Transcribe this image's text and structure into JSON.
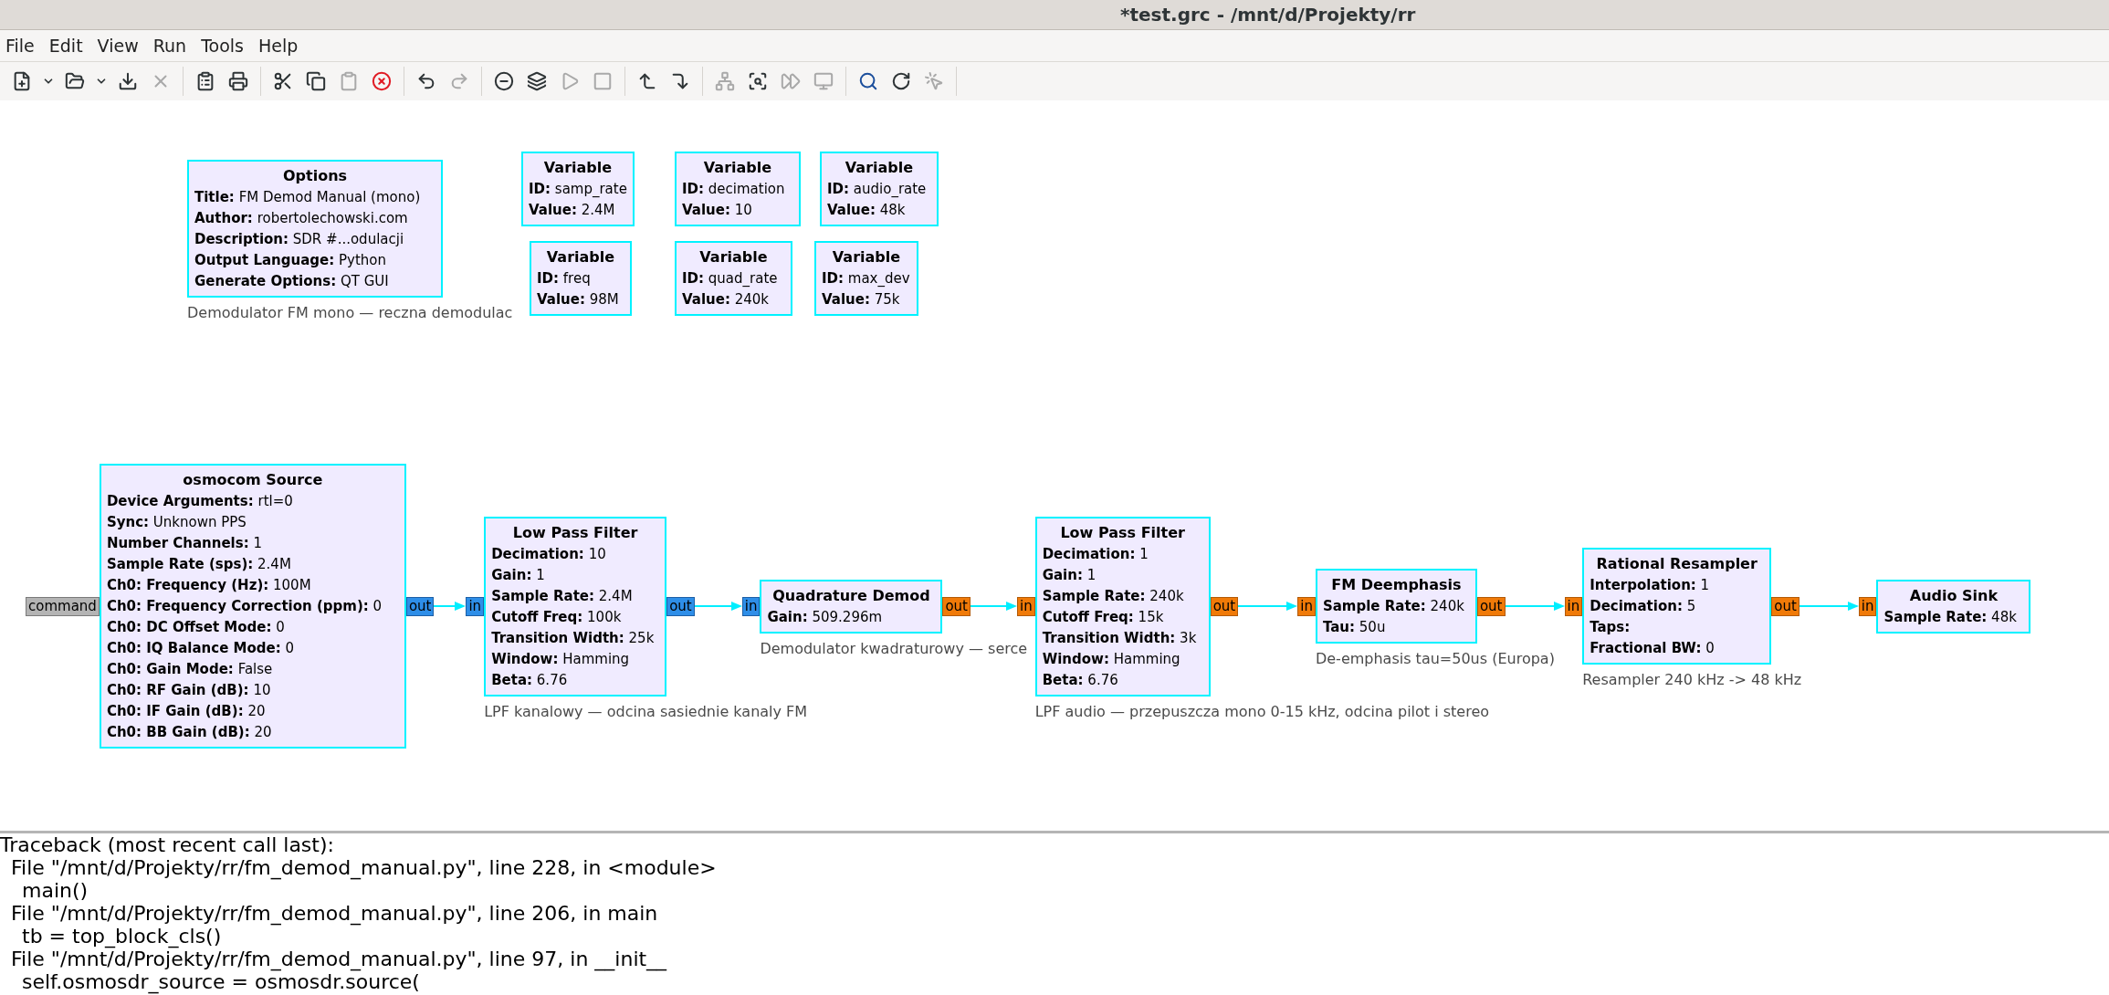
{
  "window": {
    "title": "*test.grc - /mnt/d/Projekty/rr"
  },
  "menu": [
    "File",
    "Edit",
    "View",
    "Run",
    "Tools",
    "Help"
  ],
  "toolbar": [
    [
      {
        "disabled": false
      },
      {
        "disabled": false
      },
      {
        "disabled": false
      },
      {
        "disabled": false
      },
      {
        "disabled": false
      },
      {
        "disabled": true
      }
    ],
    [
      {
        "disabled": false
      },
      {
        "disabled": false
      }
    ],
    [
      {
        "disabled": false
      },
      {
        "disabled": false
      },
      {
        "disabled": true
      },
      {
        "disabled": false
      }
    ],
    [
      {
        "disabled": false
      },
      {
        "disabled": true
      }
    ],
    [
      {
        "disabled": false
      },
      {
        "disabled": false
      },
      {
        "disabled": true
      },
      {
        "disabled": true
      }
    ],
    [
      {
        "disabled": false
      },
      {
        "disabled": false
      }
    ],
    [
      {
        "disabled": true
      },
      {
        "disabled": false
      },
      {
        "disabled": true
      },
      {
        "disabled": true
      }
    ],
    [
      {
        "disabled": false
      },
      {
        "disabled": false
      },
      {
        "disabled": true
      }
    ]
  ],
  "blocks": [
    {
      "title": "Options",
      "params": [
        {
          "name": "Title:",
          "value": "FM Demod Manual (mono)"
        },
        {
          "name": "Author:",
          "value": "robertolechowski.com"
        },
        {
          "name": "Description:",
          "value": "SDR #...odulacji"
        },
        {
          "name": "Output Language:",
          "value": "Python"
        },
        {
          "name": "Generate Options:",
          "value": "QT GUI"
        }
      ],
      "comment": "Demodulator FM mono — reczna demodulac"
    },
    {
      "title": "Variable",
      "params": [
        {
          "name": "ID:",
          "value": "samp_rate"
        },
        {
          "name": "Value:",
          "value": "2.4M"
        }
      ]
    },
    {
      "title": "Variable",
      "params": [
        {
          "name": "ID:",
          "value": "freq"
        },
        {
          "name": "Value:",
          "value": "98M"
        }
      ]
    },
    {
      "title": "Variable",
      "params": [
        {
          "name": "ID:",
          "value": "decimation"
        },
        {
          "name": "Value:",
          "value": "10"
        }
      ]
    },
    {
      "title": "Variable",
      "params": [
        {
          "name": "ID:",
          "value": "quad_rate"
        },
        {
          "name": "Value:",
          "value": "240k"
        }
      ]
    },
    {
      "title": "Variable",
      "params": [
        {
          "name": "ID:",
          "value": "audio_rate"
        },
        {
          "name": "Value:",
          "value": "48k"
        }
      ]
    },
    {
      "title": "Variable",
      "params": [
        {
          "name": "ID:",
          "value": "max_dev"
        },
        {
          "name": "Value:",
          "value": "75k"
        }
      ]
    }
  ],
  "flowgraph": [
    {
      "title": "osmocom Source",
      "inputs": [
        {
          "label": "command",
          "kind": "message"
        }
      ],
      "outputs": [
        {
          "label": "out",
          "kind": "complex"
        }
      ],
      "params": [
        {
          "name": "Device Arguments:",
          "value": "rtl=0"
        },
        {
          "name": "Sync:",
          "value": "Unknown PPS"
        },
        {
          "name": "Number Channels:",
          "value": "1"
        },
        {
          "name": "Sample Rate (sps):",
          "value": "2.4M"
        },
        {
          "name": "Ch0: Frequency (Hz):",
          "value": "100M"
        },
        {
          "name": "Ch0: Frequency Correction (ppm):",
          "value": "0"
        },
        {
          "name": "Ch0: DC Offset Mode:",
          "value": "0"
        },
        {
          "name": "Ch0: IQ Balance Mode:",
          "value": "0"
        },
        {
          "name": "Ch0: Gain Mode:",
          "value": "False"
        },
        {
          "name": "Ch0: RF Gain (dB):",
          "value": "10"
        },
        {
          "name": "Ch0: IF Gain (dB):",
          "value": "20"
        },
        {
          "name": "Ch0: BB Gain (dB):",
          "value": "20"
        }
      ]
    },
    {
      "title": "Low Pass Filter",
      "inputs": [
        {
          "label": "in",
          "kind": "complex"
        }
      ],
      "outputs": [
        {
          "label": "out",
          "kind": "complex"
        }
      ],
      "params": [
        {
          "name": "Decimation:",
          "value": "10"
        },
        {
          "name": "Gain:",
          "value": "1"
        },
        {
          "name": "Sample Rate:",
          "value": "2.4M"
        },
        {
          "name": "Cutoff Freq:",
          "value": "100k"
        },
        {
          "name": "Transition Width:",
          "value": "25k"
        },
        {
          "name": "Window:",
          "value": "Hamming"
        },
        {
          "name": "Beta:",
          "value": "6.76"
        }
      ],
      "comment": "LPF kanalowy — odcina sasiednie kanaly FM"
    },
    {
      "title": "Quadrature Demod",
      "inputs": [
        {
          "label": "in",
          "kind": "complex"
        }
      ],
      "outputs": [
        {
          "label": "out",
          "kind": "float"
        }
      ],
      "params": [
        {
          "name": "Gain:",
          "value": "509.296m"
        }
      ],
      "comment": "Demodulator kwadraturowy — serce"
    },
    {
      "title": "Low Pass Filter",
      "inputs": [
        {
          "label": "in",
          "kind": "float"
        }
      ],
      "outputs": [
        {
          "label": "out",
          "kind": "float"
        }
      ],
      "params": [
        {
          "name": "Decimation:",
          "value": "1"
        },
        {
          "name": "Gain:",
          "value": "1"
        },
        {
          "name": "Sample Rate:",
          "value": "240k"
        },
        {
          "name": "Cutoff Freq:",
          "value": "15k"
        },
        {
          "name": "Transition Width:",
          "value": "3k"
        },
        {
          "name": "Window:",
          "value": "Hamming"
        },
        {
          "name": "Beta:",
          "value": "6.76"
        }
      ],
      "comment": "LPF audio — przepuszcza mono 0-15 kHz, odcina pilot i stereo"
    },
    {
      "title": "FM Deemphasis",
      "inputs": [
        {
          "label": "in",
          "kind": "float"
        }
      ],
      "outputs": [
        {
          "label": "out",
          "kind": "float"
        }
      ],
      "params": [
        {
          "name": "Sample Rate:",
          "value": "240k"
        },
        {
          "name": "Tau:",
          "value": "50u"
        }
      ],
      "comment": "De-emphasis tau=50us (Europa)"
    },
    {
      "title": "Rational Resampler",
      "inputs": [
        {
          "label": "in",
          "kind": "float"
        }
      ],
      "outputs": [
        {
          "label": "out",
          "kind": "float"
        }
      ],
      "params": [
        {
          "name": "Interpolation:",
          "value": "1"
        },
        {
          "name": "Decimation:",
          "value": "5"
        },
        {
          "name": "Taps:"
        },
        {
          "name": "Fractional BW:",
          "value": "0"
        }
      ],
      "comment": "Resampler 240 kHz -> 48 kHz"
    },
    {
      "title": "Audio Sink",
      "inputs": [
        {
          "label": "in",
          "kind": "float"
        }
      ],
      "params": [
        {
          "name": "Sample Rate:",
          "value": "48k"
        }
      ]
    }
  ],
  "console": {
    "lines": [
      {
        "kind": "header",
        "text": "Traceback (most recent call last):"
      },
      {
        "kind": "frame",
        "text": "File \"/mnt/d/Projekty/rr/fm_demod_manual.py\", line 228, in <module>"
      },
      {
        "kind": "code",
        "text": "main()"
      },
      {
        "kind": "frame",
        "text": "File \"/mnt/d/Projekty/rr/fm_demod_manual.py\", line 206, in main"
      },
      {
        "kind": "code",
        "text": "tb = top_block_cls()"
      },
      {
        "kind": "frame",
        "text": "File \"/mnt/d/Projekty/rr/fm_demod_manual.py\", line 97, in __init__"
      },
      {
        "kind": "code",
        "text": "self.osmosdr_source = osmosdr.source("
      }
    ]
  }
}
